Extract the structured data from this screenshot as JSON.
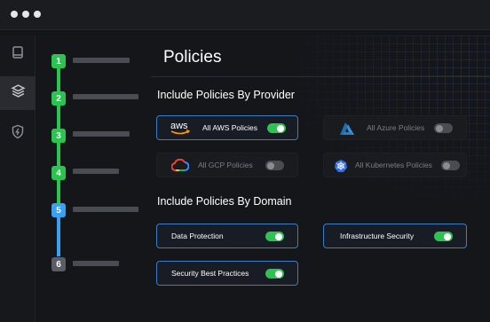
{
  "window": {
    "controls": [
      "dot",
      "dot",
      "dot"
    ]
  },
  "rail": {
    "items": [
      {
        "icon": "book-icon",
        "active": false
      },
      {
        "icon": "layers-icon",
        "active": true
      },
      {
        "icon": "shield-bolt-icon",
        "active": false
      }
    ]
  },
  "stepper": {
    "steps": [
      {
        "number": "1",
        "state": "done"
      },
      {
        "number": "2",
        "state": "done"
      },
      {
        "number": "3",
        "state": "done"
      },
      {
        "number": "4",
        "state": "done"
      },
      {
        "number": "5",
        "state": "current"
      },
      {
        "number": "6",
        "state": "todo"
      }
    ]
  },
  "page": {
    "title": "Policies"
  },
  "providers": {
    "heading": "Include Policies By Provider",
    "items": [
      {
        "logo": "aws-icon",
        "logo_text": "aws",
        "label": "All AWS Policies",
        "enabled": true
      },
      {
        "logo": "azure-icon",
        "label": "All Azure Policies",
        "enabled": false
      },
      {
        "logo": "gcp-icon",
        "label": "All GCP Policies",
        "enabled": false
      },
      {
        "logo": "kubernetes-icon",
        "label": "All Kubernetes Policies",
        "enabled": false
      }
    ]
  },
  "domains": {
    "heading": "Include Policies By Domain",
    "items": [
      {
        "label": "Data Protection",
        "enabled": true
      },
      {
        "label": "Infrastructure Security",
        "enabled": true
      },
      {
        "label": "Security Best Practices",
        "enabled": true
      }
    ]
  },
  "colors": {
    "accent_green": "#2bc451",
    "accent_blue": "#3aa0f0",
    "card_border_active": "#3d7bc4",
    "background": "#141518"
  }
}
